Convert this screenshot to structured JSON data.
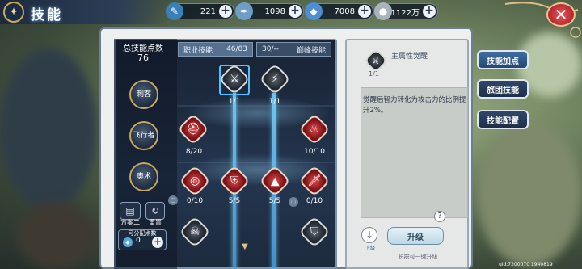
{
  "header": {
    "title": "技能"
  },
  "resources": [
    {
      "icon": "feather-icon",
      "value": "221"
    },
    {
      "icon": "quill-icon",
      "value": "1098"
    },
    {
      "icon": "crystal-icon",
      "value": "7008"
    },
    {
      "icon": "coin-icon",
      "value": "1122万"
    }
  ],
  "skill_tree": {
    "total_points_label": "总技能点数",
    "total_points": "76",
    "job_tab_label": "职业技能",
    "job_tab_value": "46/83",
    "peak_tab_value": "30/--",
    "peak_tab_label": "巅峰技能",
    "class_buttons": [
      "刺客",
      "飞行者",
      "奥术"
    ],
    "skills": [
      {
        "level": "1/1"
      },
      {
        "level": "1/1"
      },
      {
        "level": "8/20"
      },
      {
        "level": "10/10"
      },
      {
        "level": "0/10"
      },
      {
        "level": "5/5"
      },
      {
        "level": "5/5"
      },
      {
        "level": "0/10"
      }
    ],
    "plan_label": "方案二",
    "reset_label": "重置",
    "allocatable_label": "可分配点数",
    "allocatable_value": "0"
  },
  "detail": {
    "skill_name": "主属性觉醒",
    "skill_level": "1/1",
    "description": "觉醒后智力转化为攻击力的比例提升2%。",
    "upgrade_label": "升级",
    "down_label": "下级",
    "hint": "长按可一键升级"
  },
  "side_menu": [
    {
      "label": "技能加点",
      "active": true
    },
    {
      "label": "旅团技能",
      "active": false
    },
    {
      "label": "技能配置",
      "active": false
    }
  ],
  "uid": "uid:7200070 1940819"
}
